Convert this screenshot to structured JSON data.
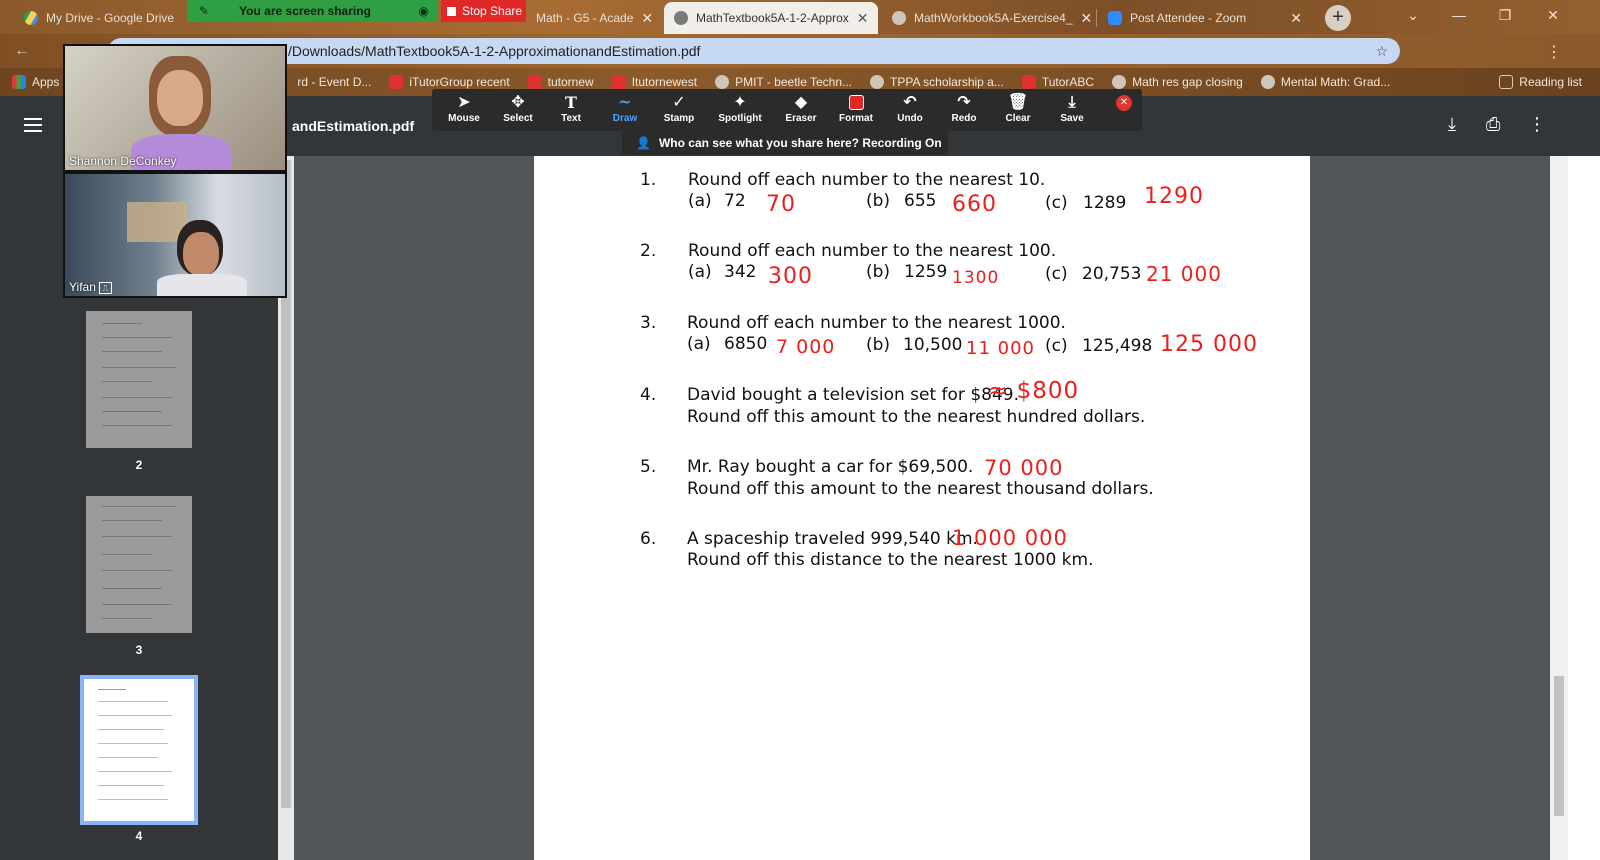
{
  "browser": {
    "tabs": [
      {
        "title": "My Drive - Google Drive"
      },
      {
        "title": "Math - G5 - Acade"
      },
      {
        "title": "MathTextbook5A-1-2-Approx"
      },
      {
        "title": "MathWorkbook5A-Exercise4_"
      },
      {
        "title": "Post Attendee - Zoom"
      }
    ],
    "address_path": "/Downloads/MathTextbook5A-1-2-ApproximationandEstimation.pdf",
    "bookmarks": [
      "Apps",
      "rd - Event D...",
      "iTutorGroup recent",
      "tutornew",
      "Itutornewest",
      "PMIT - beetle Techn...",
      "TPPA scholarship a...",
      "TutorABC",
      "Math res gap closing",
      "Mental Math: Grad...",
      "Reading list"
    ]
  },
  "sharing": {
    "status": "You are screen sharing",
    "stop_label": "Stop Share"
  },
  "pdf_viewer": {
    "title": "andEstimation.pdf",
    "thumbnails": [
      {
        "num": "2"
      },
      {
        "num": "3"
      },
      {
        "num": "4"
      }
    ]
  },
  "annotation_toolbar": {
    "tools": [
      "Mouse",
      "Select",
      "Text",
      "Draw",
      "Stamp",
      "Spotlight",
      "Eraser",
      "Format",
      "Undo",
      "Redo",
      "Clear",
      "Save"
    ],
    "active": "Draw",
    "recording_notice": "Who can see what you share here? Recording On"
  },
  "participants": [
    {
      "name": "Shannon DeConkey"
    },
    {
      "name": "Yifan"
    }
  ],
  "document": {
    "questions": [
      {
        "num": "1.",
        "text": "Round off each number to the nearest 10.",
        "parts": [
          [
            "(a)",
            "72"
          ],
          [
            "(b)",
            "655"
          ],
          [
            "(c)",
            "1289"
          ]
        ],
        "answers": [
          "70",
          "660",
          "1290"
        ]
      },
      {
        "num": "2.",
        "text": "Round off each number to the nearest 100.",
        "parts": [
          [
            "(a)",
            "342"
          ],
          [
            "(b)",
            "1259"
          ],
          [
            "(c)",
            "20,753"
          ]
        ],
        "answers": [
          "300",
          "1300",
          "21 000"
        ]
      },
      {
        "num": "3.",
        "text": "Round off each number to the nearest 1000.",
        "parts": [
          [
            "(a)",
            "6850"
          ],
          [
            "(b)",
            "10,500"
          ],
          [
            "(c)",
            "125,498"
          ]
        ],
        "answers": [
          "7 000",
          "11 000",
          "125 000"
        ]
      },
      {
        "num": "4.",
        "text": "David bought a television set for $849.",
        "text2": "Round off this amount to the nearest hundred dollars.",
        "answer": "≈ $800"
      },
      {
        "num": "5.",
        "text": "Mr. Ray bought a car for $69,500.",
        "text2": "Round off this amount to the nearest thousand dollars.",
        "answer": "70 000"
      },
      {
        "num": "6.",
        "text": "A spaceship traveled 999,540 km.",
        "text2": "Round off this distance to the nearest 1000 km.",
        "answer": "1 000 000"
      }
    ]
  },
  "colors": {
    "annotation_ink": "#e8201e",
    "share_green": "#2ea043",
    "stop_red": "#e02828"
  }
}
